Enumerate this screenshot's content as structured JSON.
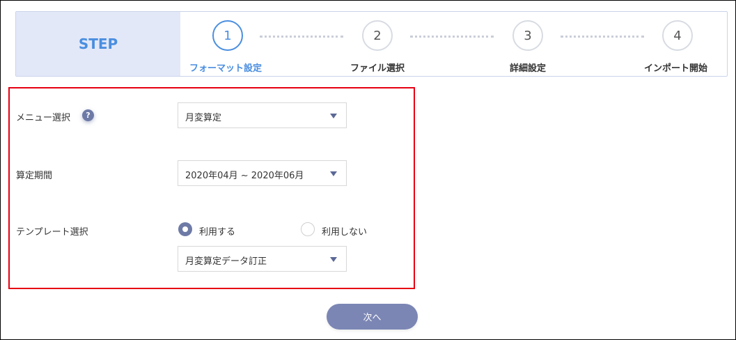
{
  "step_bar": {
    "title": "STEP",
    "steps": [
      {
        "number": "1",
        "label": "フォーマット設定",
        "active": true
      },
      {
        "number": "2",
        "label": "ファイル選択",
        "active": false
      },
      {
        "number": "3",
        "label": "詳細設定",
        "active": false
      },
      {
        "number": "4",
        "label": "インポート開始",
        "active": false
      }
    ]
  },
  "form": {
    "menu": {
      "label": "メニュー選択",
      "help": "?",
      "value": "月変算定"
    },
    "period": {
      "label": "算定期間",
      "value": "2020年04月 ~ 2020年06月"
    },
    "template": {
      "label": "テンプレート選択",
      "option_use": "利用する",
      "option_no_use": "利用しない",
      "selected": "利用する",
      "value": "月変算定データ訂正"
    }
  },
  "actions": {
    "next_label": "次へ"
  },
  "colors": {
    "accent": "#4a8ee0",
    "step_label_bg": "#e3e8f8",
    "button": "#7b86b4",
    "highlight_border": "#e60012"
  },
  "icons": {
    "help": "question-circle-icon",
    "dropdown": "caret-down-icon",
    "radio": "radio-icon"
  }
}
